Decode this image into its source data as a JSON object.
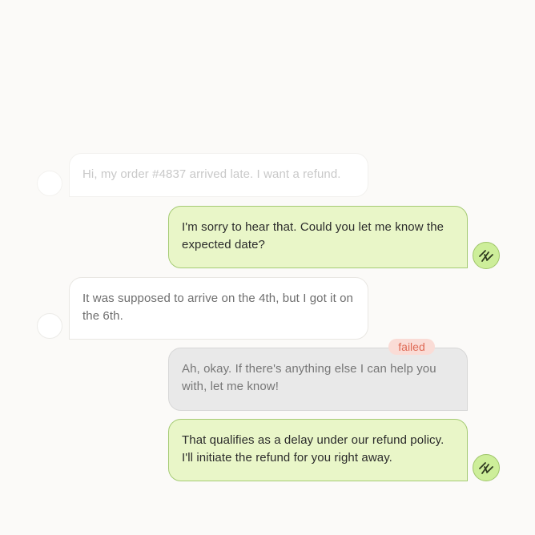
{
  "messages": [
    {
      "sender": "user",
      "text": "Hi, my order #4837 arrived late. I want a refund.",
      "status": "faded"
    },
    {
      "sender": "agent",
      "text": "I'm sorry to hear that. Could you let me know the expected date?",
      "status": "sent"
    },
    {
      "sender": "user",
      "text": "It was supposed to arrive on the 4th, but I got it on the 6th.",
      "status": "sent"
    },
    {
      "sender": "agent",
      "text": "Ah, okay. If there's anything else I can help you with, let me know!",
      "status": "failed"
    },
    {
      "sender": "agent",
      "text": "That qualifies as a delay under our refund policy. I'll initiate the refund for you right away.",
      "status": "sent"
    }
  ],
  "failed_label": "failed",
  "agent_avatar_icon": "agent-logo-icon",
  "colors": {
    "agent_bubble": "#e9f6c8",
    "agent_border": "#a5cb74",
    "failed_bubble": "#e9e9e9",
    "failed_badge_bg": "#fadcd6",
    "failed_badge_text": "#df6a55"
  }
}
